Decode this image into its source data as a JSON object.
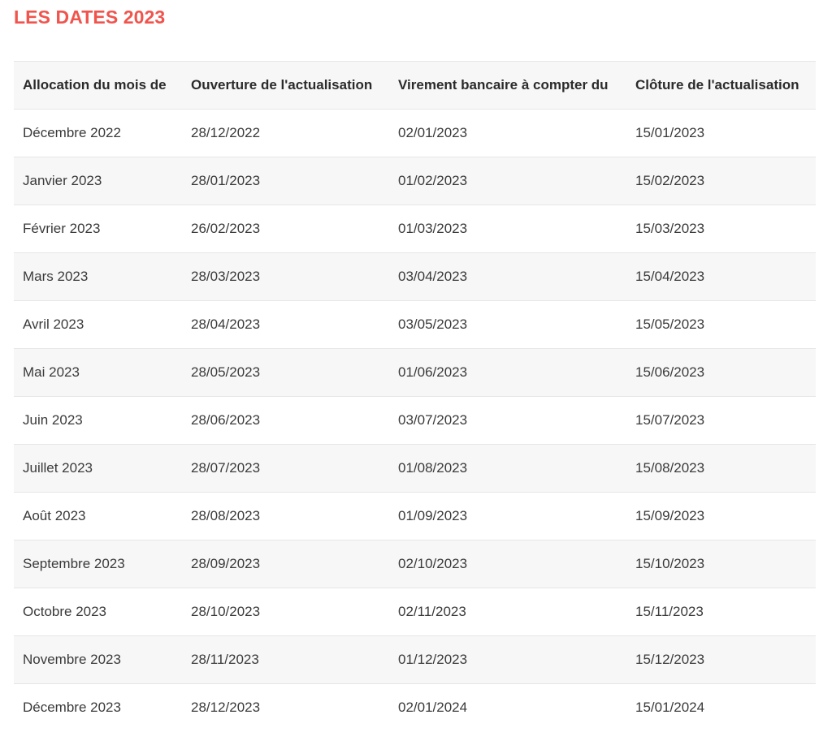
{
  "title": "LES DATES 2023",
  "table": {
    "headers": [
      "Allocation du mois de",
      "Ouverture de l'actualisation",
      "Virement bancaire à compter du",
      "Clôture de l'actualisation"
    ],
    "rows": [
      [
        "Décembre 2022",
        "28/12/2022",
        "02/01/2023",
        "15/01/2023"
      ],
      [
        "Janvier 2023",
        "28/01/2023",
        "01/02/2023",
        "15/02/2023"
      ],
      [
        "Février 2023",
        "26/02/2023",
        "01/03/2023",
        "15/03/2023"
      ],
      [
        "Mars 2023",
        "28/03/2023",
        "03/04/2023",
        "15/04/2023"
      ],
      [
        "Avril 2023",
        "28/04/2023",
        "03/05/2023",
        "15/05/2023"
      ],
      [
        "Mai 2023",
        "28/05/2023",
        "01/06/2023",
        "15/06/2023"
      ],
      [
        "Juin 2023",
        "28/06/2023",
        "03/07/2023",
        "15/07/2023"
      ],
      [
        "Juillet 2023",
        "28/07/2023",
        "01/08/2023",
        "15/08/2023"
      ],
      [
        "Août 2023",
        "28/08/2023",
        "01/09/2023",
        "15/09/2023"
      ],
      [
        "Septembre 2023",
        "28/09/2023",
        "02/10/2023",
        "15/10/2023"
      ],
      [
        "Octobre 2023",
        "28/10/2023",
        "02/11/2023",
        "15/11/2023"
      ],
      [
        "Novembre 2023",
        "28/11/2023",
        "01/12/2023",
        "15/12/2023"
      ],
      [
        "Décembre 2023",
        "28/12/2023",
        "02/01/2024",
        "15/01/2024"
      ]
    ]
  },
  "colors": {
    "title": "#f0544d",
    "row_alt": "#f7f7f7",
    "border": "#e6e6e6"
  }
}
